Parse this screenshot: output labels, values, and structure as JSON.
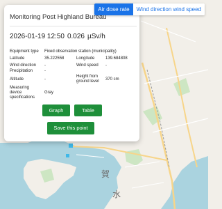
{
  "tabs": {
    "air_dose": "Air dose rate",
    "wind": "Wind direction wind speed"
  },
  "popup": {
    "title": "Monitoring Post Highland Bureau",
    "close_glyph": "×",
    "timestamp": "2026-01-19 12:50",
    "dose_value": "0.026",
    "dose_unit": "µSv/h"
  },
  "details": {
    "equipment_type_label": "Equipment type",
    "equipment_type_value": "Fixed observation station (municipality)",
    "latitude_label": "Latitude",
    "latitude_value": "35.222558",
    "longitude_label": "Longitude",
    "longitude_value": "139.684808",
    "wind_direction_label": "Wind direction",
    "wind_direction_value": "-",
    "wind_speed_label": "Wind speed",
    "wind_speed_value": "-",
    "precipitation_label": "Precipitation",
    "precipitation_value": "-",
    "altitude_label": "Altitude",
    "altitude_value": "-",
    "height_label_1": "Height from",
    "height_label_2": "ground level",
    "height_value": "370 cm",
    "specs_label_1": "Measuring",
    "specs_label_2": "device",
    "specs_label_3": "specifications",
    "specs_value": "Gray"
  },
  "buttons": {
    "graph": "Graph",
    "table": "Table",
    "save": "Save this point"
  },
  "map_labels": {
    "kanji_ga": "賀",
    "kanji_mizu": "水"
  },
  "colors": {
    "accent": "#1a73e8",
    "button_green": "#1e8f3a",
    "water": "#aad3df",
    "land": "#f2efe9",
    "park": "#cde6c3",
    "road": "#f7d58a",
    "station_marker": "#3fb8e8"
  }
}
